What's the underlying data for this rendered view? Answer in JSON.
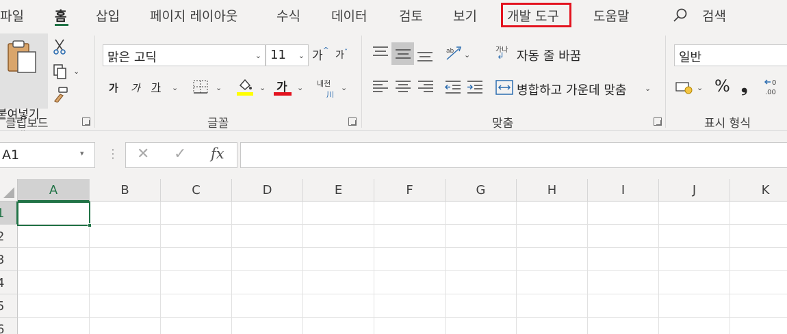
{
  "ribbon_tabs": [
    "파일",
    "홈",
    "삽입",
    "페이지 레이아웃",
    "수식",
    "데이터",
    "검토",
    "보기",
    "개발 도구",
    "도움말"
  ],
  "search_label": "검색",
  "active_tab": "홈",
  "highlighted_tab": "개발 도구",
  "clipboard": {
    "group_label": "클립보드",
    "paste_label": "붙여넣기"
  },
  "font": {
    "group_label": "글꼴",
    "font_name": "맑은 고딕",
    "font_size": "11",
    "increase_size": "가",
    "decrease_size": "가",
    "bold": "가",
    "italic": "가",
    "underline": "가",
    "font_color": "가",
    "phonetic_line1": "내천",
    "phonetic_line2": "川",
    "fill_color": "#ffff00",
    "text_color": "#e3131f"
  },
  "alignment": {
    "group_label": "맞춤",
    "wrap_text": "자동 줄 바꿈",
    "merge_center": "병합하고 가운데 맞춤",
    "wrap_icon_text": "가나"
  },
  "number": {
    "group_label": "표시 형식",
    "format": "일반",
    "percent": "%",
    "comma": "❟"
  },
  "formula_bar": {
    "name_box": "A1",
    "fx": "fx",
    "value": ""
  },
  "columns": [
    "A",
    "B",
    "C",
    "D",
    "E",
    "F",
    "G",
    "H",
    "I",
    "J",
    "K"
  ],
  "rows": [
    "1",
    "2",
    "3",
    "4",
    "5",
    "6"
  ],
  "selected_cell": "A1",
  "colors": {
    "accent": "#217346",
    "highlight": "#e3131f"
  }
}
